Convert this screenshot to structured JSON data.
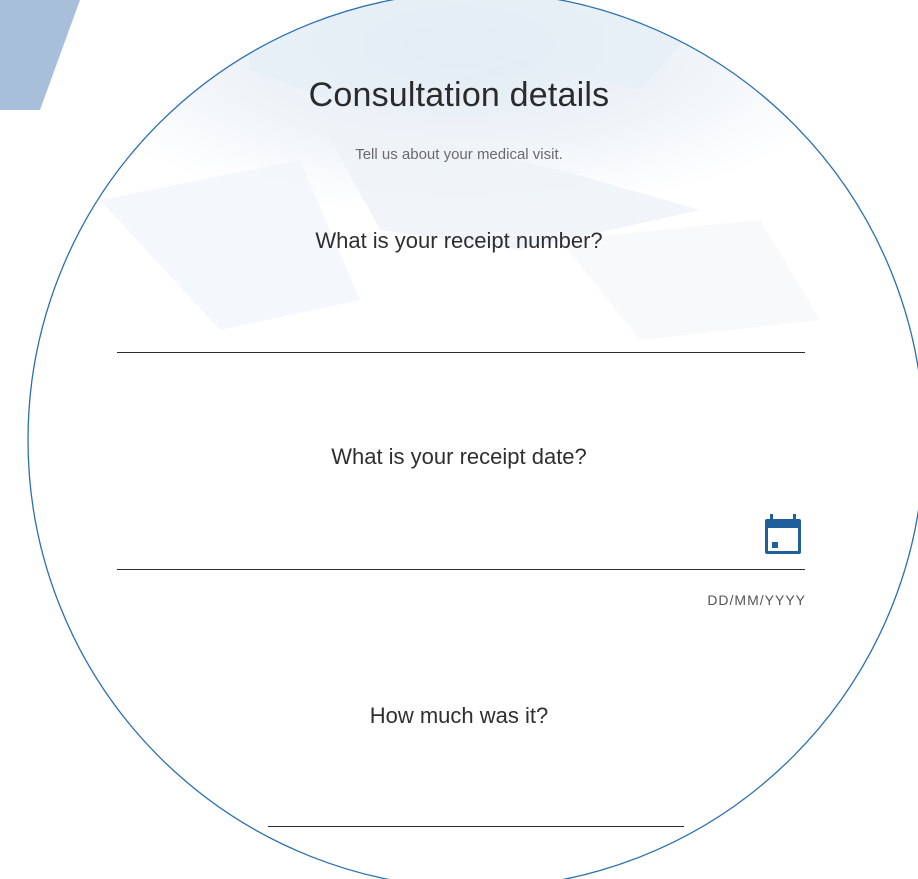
{
  "form": {
    "title": "Consultation details",
    "subtitle": "Tell us about your medical visit.",
    "receipt_number": {
      "label": "What is your receipt number?",
      "value": ""
    },
    "receipt_date": {
      "label": "What is your receipt date?",
      "value": "",
      "format_hint": "DD/MM/YYYY",
      "icon": "calendar-icon"
    },
    "amount": {
      "label": "How much was it?",
      "value": ""
    }
  },
  "colors": {
    "accent": "#1f5f9b",
    "circle_border": "#2a6fb0",
    "stripe": "#a8bfdc",
    "text": "#2b2b2b",
    "muted": "#6a6a6a"
  }
}
